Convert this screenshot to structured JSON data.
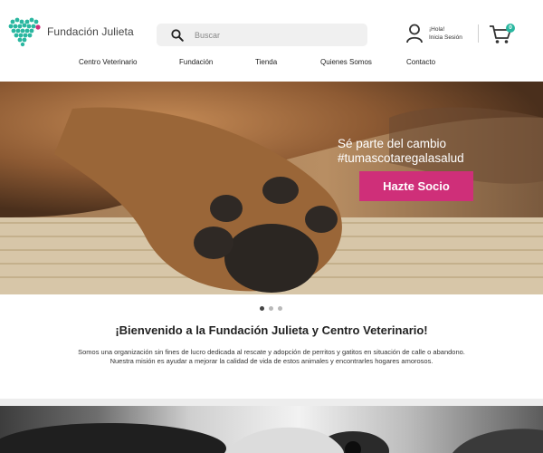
{
  "brand": {
    "name": "Fundación Julieta",
    "accent": "#2ab7a0",
    "pink": "#cf2f79"
  },
  "search": {
    "placeholder": "Buscar"
  },
  "account": {
    "line1": "¡Hola!",
    "line2": "Inicia Sesión"
  },
  "cart": {
    "count": "0"
  },
  "nav": [
    "Centro Veterinario",
    "Fundación",
    "Tienda",
    "Quienes Somos",
    "Contacto"
  ],
  "hero": {
    "line1": "Sé parte del cambio",
    "line2": "#tumascotaregalasalud",
    "button": "Hazte Socio",
    "slides": 3,
    "active_slide": 1
  },
  "welcome": {
    "title": "¡Bienvenido a la Fundación Julieta y Centro Veterinario!",
    "text1": "Somos una organización sin fines de lucro dedicada al rescate y adopción de perritos y gatitos en situación de calle o abandono.",
    "text2": "Nuestra misión es ayudar a mejorar la calidad de vida de estos animales y encontrarles hogares amorosos."
  },
  "icons": [
    "logo-heart-icon",
    "search-icon",
    "user-icon",
    "cart-icon"
  ]
}
